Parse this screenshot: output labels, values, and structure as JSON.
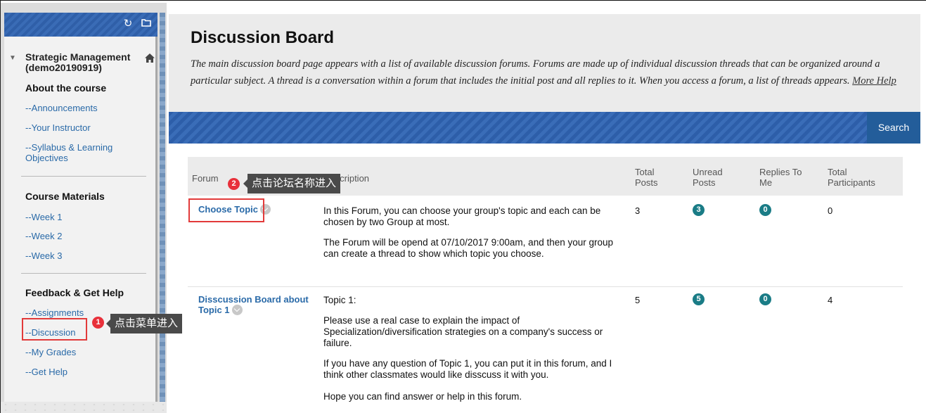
{
  "sidebar": {
    "course_title": "Strategic Management (demo20190919)",
    "sections": [
      {
        "heading": "About the course",
        "links": [
          "--Announcements",
          "--Your Instructor",
          "--Syllabus & Learning Objectives"
        ]
      },
      {
        "heading": "Course Materials",
        "links": [
          "--Week 1",
          "--Week 2",
          "--Week 3"
        ]
      },
      {
        "heading": "Feedback & Get Help",
        "links": [
          "--Assignments",
          "--Discussion",
          "--My Grades",
          "--Get Help"
        ]
      }
    ],
    "icons": {
      "refresh": "refresh-icon",
      "folder": "folder-icon",
      "home": "home-icon",
      "collapse": "caret-down-icon"
    }
  },
  "header": {
    "title": "Discussion Board",
    "description": "The main discussion board page appears with a list of available discussion forums. Forums are made up of individual discussion threads that can be organized around a particular subject. A thread is a conversation within a forum that includes the initial post and all replies to it. When you access a forum, a list of threads appears.",
    "more_help": "More Help"
  },
  "toolbar": {
    "search_label": "Search"
  },
  "table": {
    "columns": {
      "forum": "Forum",
      "description": "Description",
      "total_posts": "Total Posts",
      "unread_posts": "Unread Posts",
      "replies_to_me": "Replies To Me",
      "total_participants": "Total Participants"
    },
    "rows": [
      {
        "forum": "Choose Topic",
        "description": [
          "In this Forum, you can choose your group's topic and each can be chosen by two Group at most.",
          "The Forum will be opend at 07/10/2017 9:00am, and then your group can create a thread to show which topic you choose."
        ],
        "total_posts": "3",
        "unread_posts": "3",
        "replies_to_me": "0",
        "total_participants": "0"
      },
      {
        "forum": "Disscussion Board about Topic 1",
        "description": [
          "Topic 1:",
          "Please use a real case to explain the impact of Specialization/diversification strategies on a company's success or failure.",
          "If you have any question of Topic 1, you can put it in this forum, and I think other classmates would like disscuss it with you.",
          "Hope you can find answer or help in this forum."
        ],
        "total_posts": "5",
        "unread_posts": "5",
        "replies_to_me": "0",
        "total_participants": "4"
      }
    ]
  },
  "annotations": [
    {
      "step": "1",
      "text": "点击菜单进入"
    },
    {
      "step": "2",
      "text": "点击论坛名称进入"
    }
  ],
  "colors": {
    "link": "#2a6aa8",
    "toolbar": "#2d5ea9",
    "badge": "#1a7c86",
    "highlight": "#e23a3a"
  }
}
